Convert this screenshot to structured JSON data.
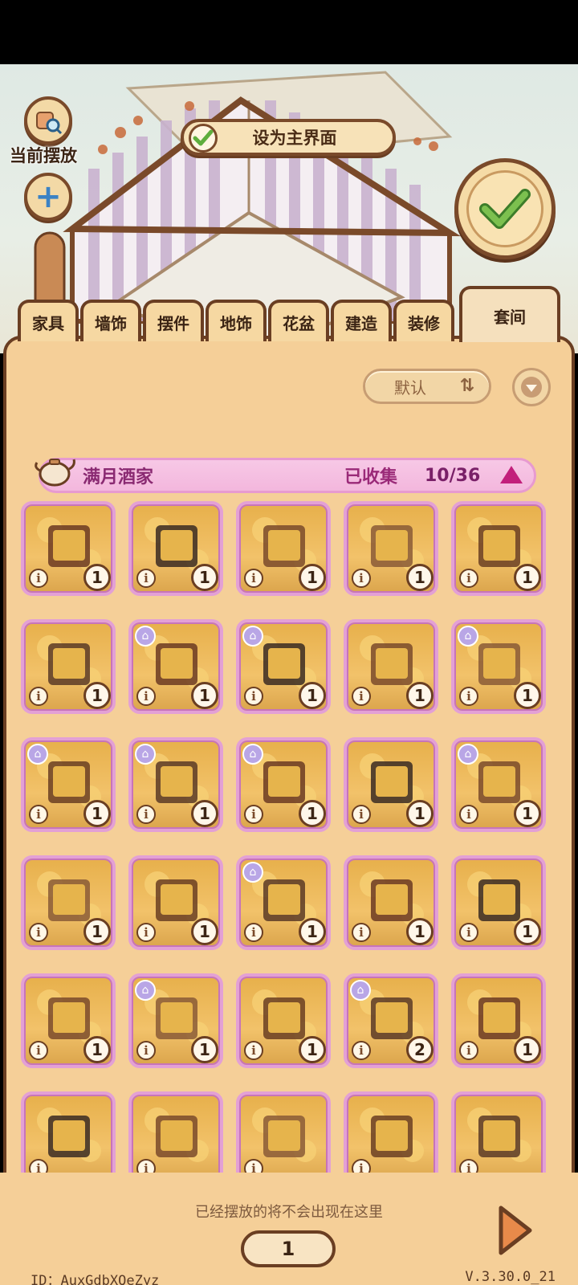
{
  "scene": {
    "current_placement_label": "当前摆放",
    "set_main_label": "设为主界面"
  },
  "tabs": [
    {
      "label": "家具"
    },
    {
      "label": "墙饰"
    },
    {
      "label": "摆件"
    },
    {
      "label": "地饰"
    },
    {
      "label": "花盆"
    },
    {
      "label": "建造"
    },
    {
      "label": "装修"
    },
    {
      "label": "套间",
      "active": true
    }
  ],
  "sort": {
    "label": "默认"
  },
  "set": {
    "name": "满月酒家",
    "collected_label": "已收集",
    "count": "10/36"
  },
  "items": [
    {
      "qty": "1",
      "tag": false
    },
    {
      "qty": "1",
      "tag": false
    },
    {
      "qty": "1",
      "tag": false
    },
    {
      "qty": "1",
      "tag": false
    },
    {
      "qty": "1",
      "tag": false
    },
    {
      "qty": "1",
      "tag": false
    },
    {
      "qty": "1",
      "tag": true
    },
    {
      "qty": "1",
      "tag": true
    },
    {
      "qty": "1",
      "tag": false
    },
    {
      "qty": "1",
      "tag": true
    },
    {
      "qty": "1",
      "tag": true
    },
    {
      "qty": "1",
      "tag": true
    },
    {
      "qty": "1",
      "tag": true
    },
    {
      "qty": "1",
      "tag": false
    },
    {
      "qty": "1",
      "tag": true
    },
    {
      "qty": "1",
      "tag": false
    },
    {
      "qty": "1",
      "tag": false
    },
    {
      "qty": "1",
      "tag": true
    },
    {
      "qty": "1",
      "tag": false
    },
    {
      "qty": "1",
      "tag": false
    },
    {
      "qty": "1",
      "tag": false
    },
    {
      "qty": "1",
      "tag": true
    },
    {
      "qty": "1",
      "tag": false
    },
    {
      "qty": "2",
      "tag": true
    },
    {
      "qty": "1",
      "tag": false
    },
    {
      "qty": "",
      "tag": false
    },
    {
      "qty": "",
      "tag": false
    },
    {
      "qty": "",
      "tag": false
    },
    {
      "qty": "",
      "tag": false
    },
    {
      "qty": "",
      "tag": false
    }
  ],
  "footer": {
    "hint": "已经摆放的将不会出现在这里",
    "page": "1",
    "id": "ID：AuxGdbXQeZyz",
    "version": "V.3.30.0_21"
  },
  "colors": {
    "panel": "#f5cf98",
    "border": "#6a3e22",
    "set_bar": "#f3b7dd",
    "item_frame": "#e3a0d5",
    "confirm_check": "#5fae3e"
  }
}
